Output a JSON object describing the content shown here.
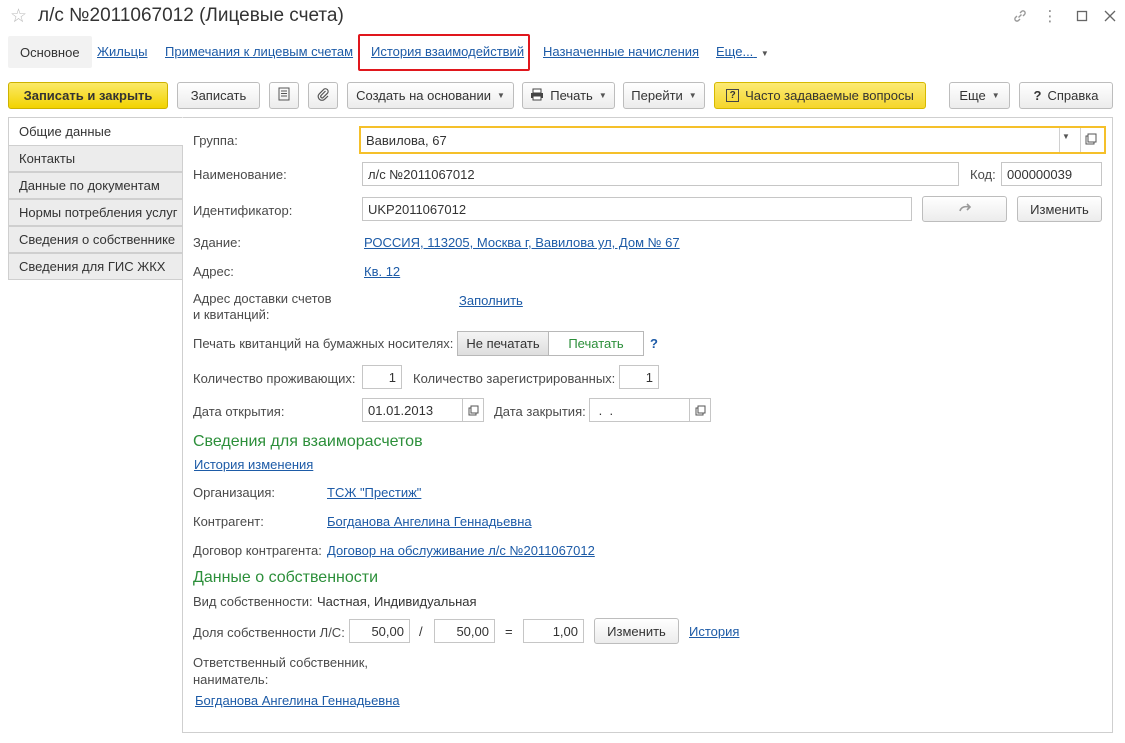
{
  "window": {
    "title": "л/с №2011067012 (Лицевые счета)"
  },
  "nav": {
    "tabs": [
      "Основное",
      "Жильцы",
      "Примечания к лицевым счетам",
      "История взаимодействий",
      "Назначенные начисления",
      "Еще..."
    ]
  },
  "toolbar": {
    "save_close": "Записать и закрыть",
    "save": "Записать",
    "create_based": "Создать на основании",
    "print": "Печать",
    "goto": "Перейти",
    "faq": "Часто задаваемые вопросы",
    "more": "Еще",
    "help": "Справка"
  },
  "side_tabs": [
    "Общие данные",
    "Контакты",
    "Данные по документам",
    "Нормы потребления услуг",
    "Сведения о собственнике",
    "Сведения для ГИС ЖКХ"
  ],
  "form": {
    "group_label": "Группа:",
    "group_value": "Вавилова, 67",
    "name_label": "Наименование:",
    "name_value": "л/с №2011067012",
    "code_label": "Код:",
    "code_value": "000000039",
    "id_label": "Идентификатор:",
    "id_value": "UKP2011067012",
    "change_label": "Изменить",
    "building_label": "Здание:",
    "building_value": "РОССИЯ, 113205, Москва г, Вавилова ул, Дом № 67",
    "address_label": "Адрес:",
    "address_value": "Кв. 12",
    "delivery_label_1": "Адрес доставки счетов",
    "delivery_label_2": "и квитанций:",
    "fill_link": "Заполнить",
    "print_label": "Печать квитанций на бумажных носителях:",
    "no_print": "Не печатать",
    "do_print": "Печатать",
    "help_q": "?",
    "residents_label": "Количество проживающих:",
    "residents_value": "1",
    "registered_label": "Количество зарегистрированных:",
    "registered_value": "1",
    "open_date_label": "Дата открытия:",
    "open_date_value": "01.01.2013",
    "close_date_label": "Дата закрытия:",
    "close_date_value": " .  .",
    "settlements_title": "Сведения для взаиморасчетов",
    "history_changes": "История изменения",
    "org_label": "Организация:",
    "org_value": "ТСЖ \"Престиж\"",
    "counterparty_label": "Контрагент:",
    "counterparty_value": "Богданова Ангелина Геннадьевна",
    "contract_label": "Договор контрагента:",
    "contract_value": "Договор на обслуживание л/с №2011067012",
    "ownership_title": "Данные о собственности",
    "ownership_type_label": "Вид собственности:",
    "ownership_type_value": "Частная, Индивидуальная",
    "share_label": "Доля собственности Л/С:",
    "share_num": "50,00",
    "share_slash": "/",
    "share_den": "50,00",
    "share_eq": "=",
    "share_result": "1,00",
    "share_change": "Изменить",
    "share_history": "История",
    "owner_label_1": "Ответственный собственник,",
    "owner_label_2": "наниматель:",
    "owner_value": "Богданова Ангелина Геннадьевна"
  },
  "colors": {
    "accent_yellow": "#f5d62b",
    "section_green": "#2c8f3a",
    "link_blue": "#1d5ba7",
    "highlight_red": "#e0171d"
  }
}
